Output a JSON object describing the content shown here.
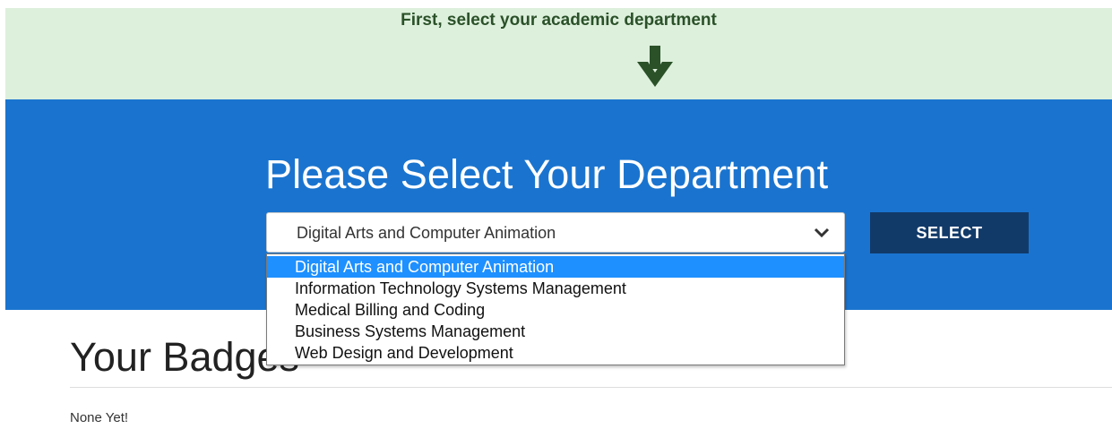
{
  "instruction": {
    "text": "First, select your academic department",
    "arrow_icon": "arrow-down-icon"
  },
  "department": {
    "title": "Please Select Your Department",
    "selected_value": "Digital Arts and Computer Animation",
    "button_label": "SELECT",
    "options": [
      "Digital Arts and Computer Animation",
      "Information Technology Systems Management",
      "Medical Billing and Coding",
      "Business Systems Management",
      "Web Design and Development"
    ],
    "highlighted_option": "Digital Arts and Computer Animation"
  },
  "badges": {
    "title": "Your Badges",
    "empty_text": "None Yet!"
  },
  "colors": {
    "instruction_bg": "#ddf0dc",
    "instruction_text": "#2b5129",
    "dept_band": "#1a74cf",
    "button_bg": "#123a69",
    "option_highlight": "#1e90ff"
  }
}
